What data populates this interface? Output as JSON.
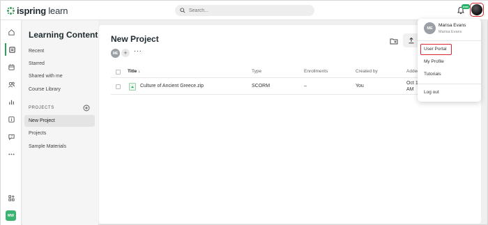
{
  "app": {
    "logo_brand": "ispring",
    "logo_product": "learn",
    "accent_color": "#2aa35a",
    "highlight_color": "#d8262f"
  },
  "search": {
    "placeholder": "Search..."
  },
  "topbar": {
    "notification_badge": "new",
    "user_avatar_icon": "user-photo"
  },
  "rail": {
    "items": [
      {
        "icon": "home-icon"
      },
      {
        "icon": "learning-content-icon"
      },
      {
        "icon": "calendar-icon"
      },
      {
        "icon": "users-icon"
      },
      {
        "icon": "reports-icon"
      },
      {
        "icon": "info-icon"
      },
      {
        "icon": "chat-icon"
      },
      {
        "icon": "more-icon"
      }
    ],
    "apps_icon": "apps-icon",
    "user_initials": "MW"
  },
  "sidebar": {
    "title": "Learning Content",
    "items": [
      "Recent",
      "Starred",
      "Shared with me",
      "Course Library"
    ],
    "projects_heading": "PROJECTS",
    "project_items": [
      "New Project",
      "Projects",
      "Sample Materials"
    ],
    "active_project": "New Project"
  },
  "main": {
    "title": "New Project",
    "owner_initials": "ME",
    "table": {
      "columns": [
        "Title",
        "Type",
        "Enrollments",
        "Created by",
        "Added"
      ],
      "visible_columns": [
        "Title",
        "Type",
        "Enrollments",
        "Created by",
        "Addec"
      ],
      "rows": [
        {
          "title": "Culture of Ancient Greece.zip",
          "type": "SCORM",
          "enrollments": "–",
          "created_by": "You",
          "added_line1": "Oct 1",
          "added_line2": "AM"
        }
      ]
    }
  },
  "dropdown": {
    "initials": "ME",
    "name": "Marisa Evans",
    "subtitle": "Marisa Evans",
    "items": [
      "User Portal",
      "My Profile",
      "Tutorials"
    ],
    "logout": "Log out",
    "highlighted_item": "User Portal"
  }
}
